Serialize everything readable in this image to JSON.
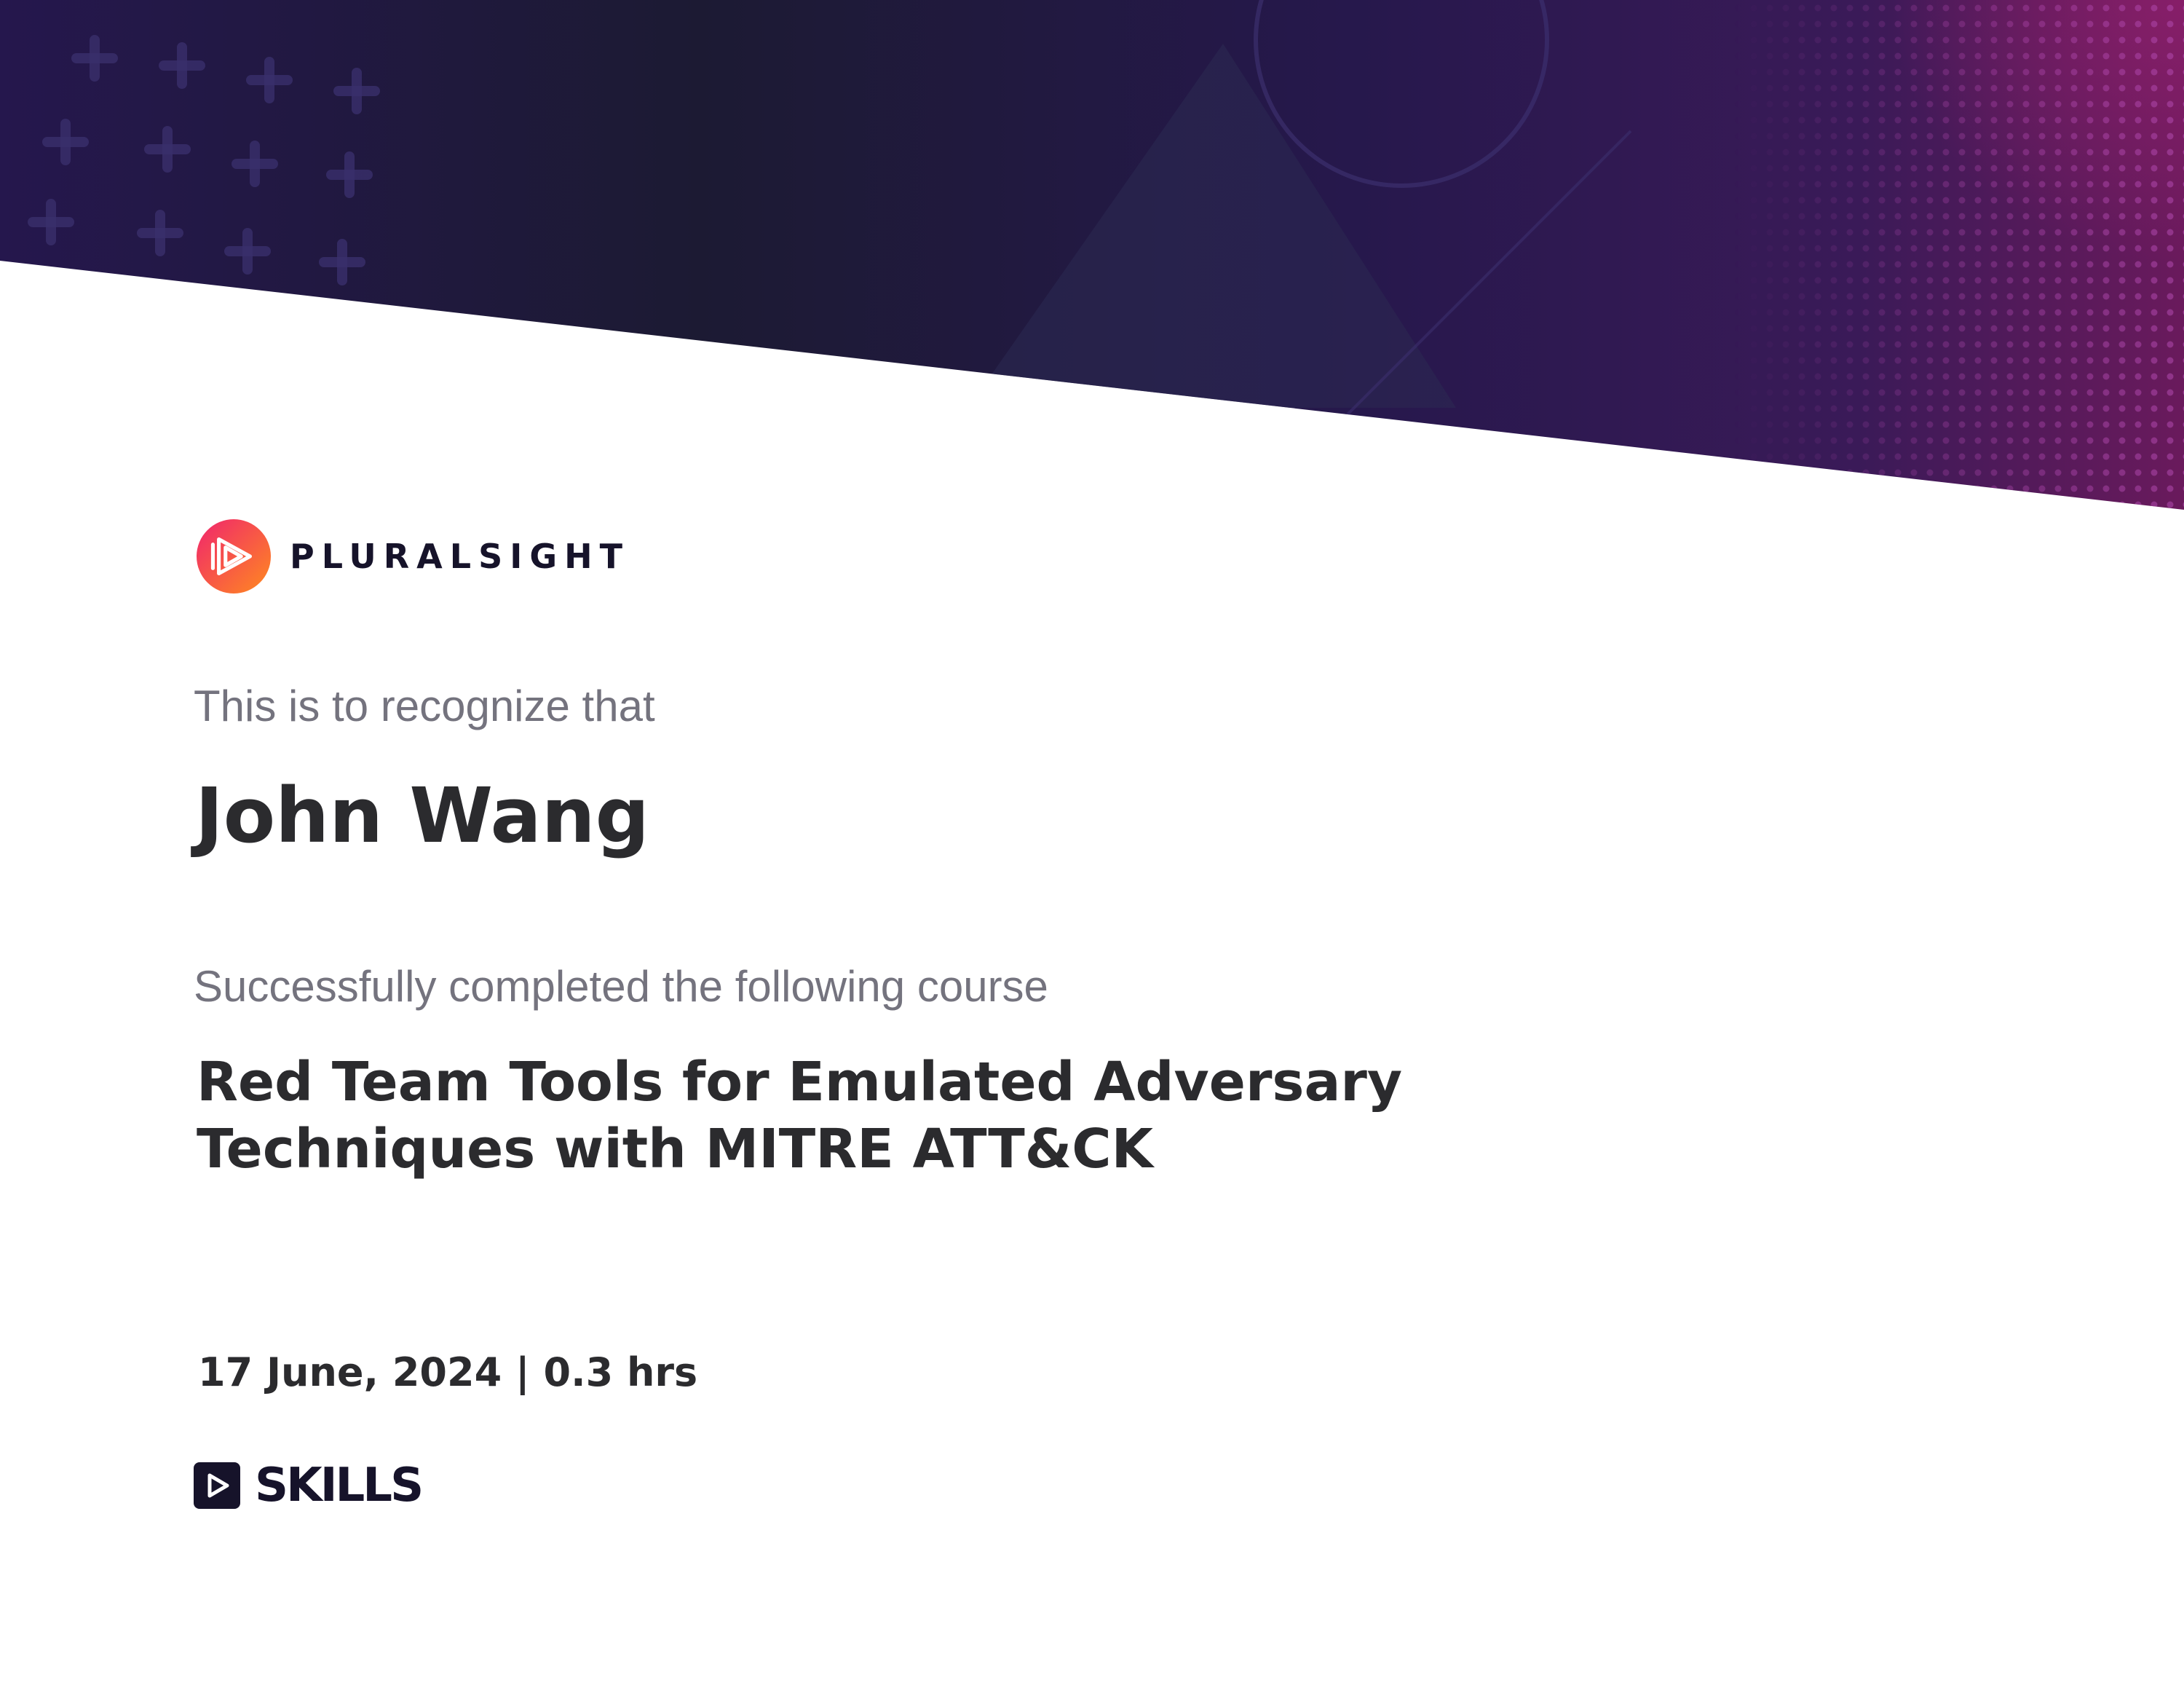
{
  "brand": {
    "name": "PLURALSIGHT",
    "logo_icon": "pluralsight-play-logo-icon",
    "logo_gradient": [
      "#f0246e",
      "#ff8a1f"
    ]
  },
  "certificate": {
    "intro": "This is to recognize that",
    "recipient": "John Wang",
    "completed_text": "Successfully completed the following course",
    "course_title_lines": [
      "Red Team Tools for Emulated Adversary",
      "Techniques with MITRE ATT&CK"
    ],
    "date": "17 June, 2024",
    "separator": "|",
    "duration": "0.3 hrs"
  },
  "footer": {
    "product": "SKILLS",
    "product_icon": "skills-play-icon"
  },
  "colors": {
    "banner_dark": "#1c1a33",
    "banner_purple": "#2a1753",
    "banner_magenta": "#6a1a5c",
    "text_dark": "#2b2b2e",
    "text_muted": "#74737e"
  }
}
